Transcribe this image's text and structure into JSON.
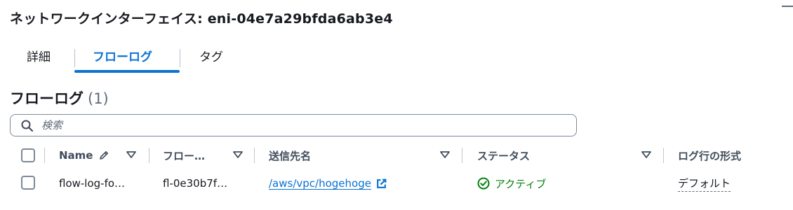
{
  "header": {
    "title": "ネットワークインターフェイス: eni-04e7a29bfda6ab3e4"
  },
  "tabs": [
    {
      "label": "詳細",
      "active": false
    },
    {
      "label": "フローログ",
      "active": true
    },
    {
      "label": "タグ",
      "active": false
    }
  ],
  "section": {
    "title": "フローログ",
    "count": "(1)"
  },
  "search": {
    "placeholder": "検索",
    "value": ""
  },
  "table": {
    "columns": [
      "Name",
      "フロー…",
      "送信先名",
      "ステータス",
      "ログ行の形式"
    ],
    "rows": [
      {
        "name": "flow-log-fo…",
        "flow_log_id": "fl-0e30b7f…",
        "destination": "/aws/vpc/hogehoge",
        "status": "アクティブ",
        "log_format": "デフォルト"
      }
    ]
  },
  "colors": {
    "accent": "#0972d3",
    "success": "#037f0c",
    "text": "#16191f",
    "muted": "#5f6b7a"
  },
  "icons": {
    "search": "search-icon",
    "edit": "pencil-icon",
    "sort": "caret-down-icon",
    "external": "external-link-icon",
    "status": "check-circle-icon"
  }
}
